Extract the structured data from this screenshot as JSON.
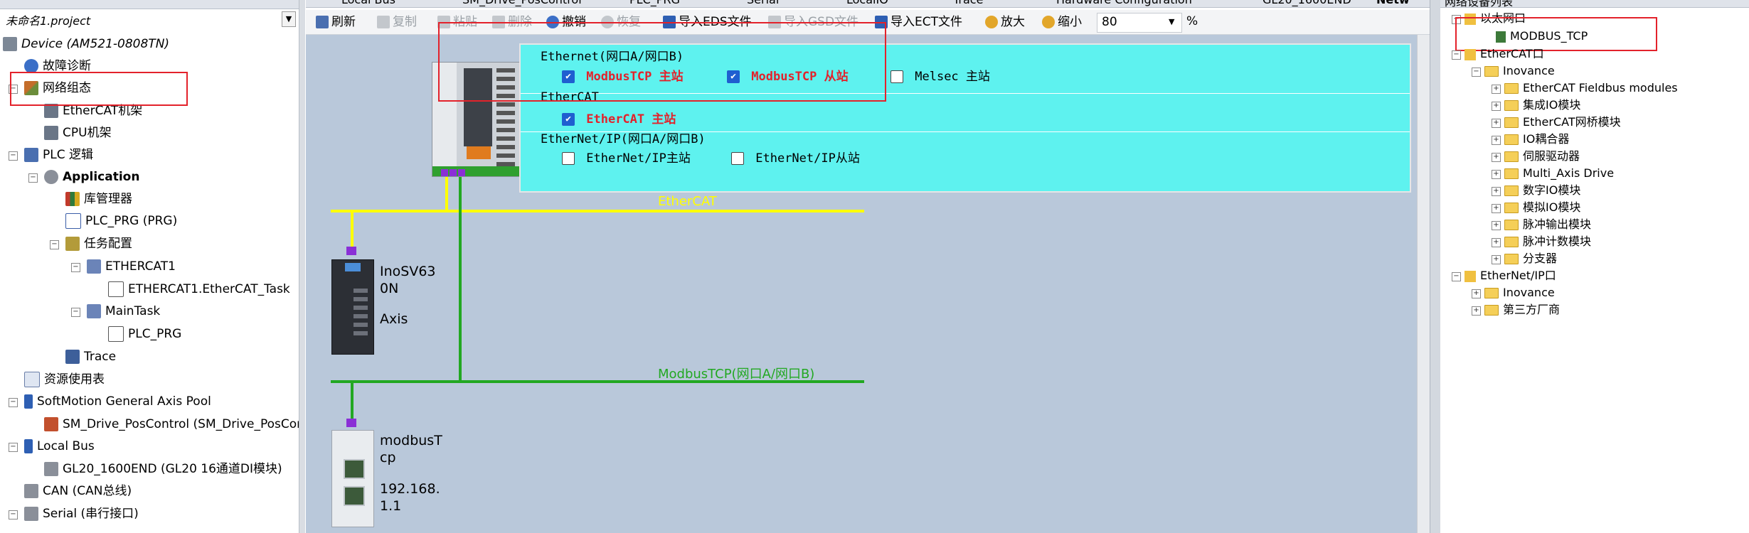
{
  "left_tree": {
    "project_name": "未命名1.project",
    "items": [
      {
        "label": "Device (AM521-0808TN)",
        "icon": "device-icon"
      },
      {
        "label": "故障诊断",
        "icon": "diagnosis-icon"
      },
      {
        "label": "网络组态",
        "icon": "network-config-icon"
      },
      {
        "label": "EtherCAT机架",
        "icon": "rack-icon"
      },
      {
        "label": "CPU机架",
        "icon": "rack-icon"
      },
      {
        "label": "PLC 逻辑",
        "icon": "plc-logic-icon"
      },
      {
        "label": "Application",
        "icon": "application-icon"
      },
      {
        "label": "库管理器",
        "icon": "library-icon"
      },
      {
        "label": "PLC_PRG (PRG)",
        "icon": "program-icon"
      },
      {
        "label": "任务配置",
        "icon": "task-config-icon"
      },
      {
        "label": "ETHERCAT1",
        "icon": "task-icon"
      },
      {
        "label": "ETHERCAT1.EtherCAT_Task",
        "icon": "task-call-icon"
      },
      {
        "label": "MainTask",
        "icon": "task-icon"
      },
      {
        "label": "PLC_PRG",
        "icon": "task-call-icon"
      },
      {
        "label": "Trace",
        "icon": "trace-icon"
      },
      {
        "label": "资源使用表",
        "icon": "resource-table-icon"
      },
      {
        "label": "SoftMotion General Axis Pool",
        "icon": "axis-pool-icon"
      },
      {
        "label": "SM_Drive_PosControl (SM_Drive_PosControl)",
        "icon": "drive-icon"
      },
      {
        "label": "Local Bus",
        "icon": "bus-icon"
      },
      {
        "label": "GL20_1600END (GL20 16通道DI模块)",
        "icon": "module-icon"
      },
      {
        "label": "CAN (CAN总线)",
        "icon": "can-icon"
      },
      {
        "label": "Serial (串行接口)",
        "icon": "serial-icon"
      }
    ]
  },
  "tabs": [
    "Local Bus",
    "SM_Drive_PosControl",
    "PLC_PRG",
    "Serial",
    "LocalIO",
    "Trace",
    "Hardware Configuration",
    "GL20_1600END",
    "Netw"
  ],
  "toolbar": {
    "refresh": "刷新",
    "copy": "复制",
    "paste": "粘贴",
    "delete": "删除",
    "undo": "撤销",
    "redo": "恢复",
    "import_eds": "导入EDS文件",
    "import_gsd": "导入GSD文件",
    "import_ect": "导入ECT文件",
    "zoom_in": "放大",
    "zoom_out": "缩小",
    "zoom_value": "80",
    "zoom_unit": "%"
  },
  "canvas": {
    "protocols": {
      "ethernet_title": "Ethernet(网口A/网口B)",
      "modbus_master": "ModbusTCP 主站",
      "modbus_slave": "ModbusTCP 从站",
      "melsec_master": "Melsec 主站",
      "ethercat_title": "EtherCAT",
      "ethercat_master": "EtherCAT 主站",
      "eip_title": "EtherNet/IP(网口A/网口B)",
      "eip_master": "EtherNet/IP主站",
      "eip_slave": "EtherNet/IP从站"
    },
    "ethercat_bus_label": "EtherCAT",
    "modbus_bus_label": "ModbusTCP(网口A/网口B)",
    "servo": {
      "name_line1": "InoSV63",
      "name_line2": "0N",
      "axis": "Axis"
    },
    "modbus_device": {
      "name_line1": "modbusT",
      "name_line2": "cp",
      "ip_line1": "192.168.",
      "ip_line2": "1.1"
    },
    "colors": {
      "ethercat_bus": "#ffff00",
      "modbus_bus": "#22a822",
      "canvas_bg": "#b9c8da",
      "panel_bg": "#5ef2ef",
      "highlight": "#e3222b"
    }
  },
  "right_tree": {
    "header": "网络设备列表",
    "items": [
      {
        "label": "以太网口"
      },
      {
        "label": "MODBUS_TCP"
      },
      {
        "label": "EtherCAT口"
      },
      {
        "label": "Inovance"
      },
      {
        "label": "EtherCAT Fieldbus modules"
      },
      {
        "label": "集成IO模块"
      },
      {
        "label": "EtherCAT网桥模块"
      },
      {
        "label": "IO耦合器"
      },
      {
        "label": "伺服驱动器"
      },
      {
        "label": "Multi_Axis Drive"
      },
      {
        "label": "数字IO模块"
      },
      {
        "label": "模拟IO模块"
      },
      {
        "label": "脉冲输出模块"
      },
      {
        "label": "脉冲计数模块"
      },
      {
        "label": "分支器"
      },
      {
        "label": "EtherNet/IP口"
      },
      {
        "label": "Inovance"
      },
      {
        "label": "第三方厂商"
      }
    ]
  }
}
